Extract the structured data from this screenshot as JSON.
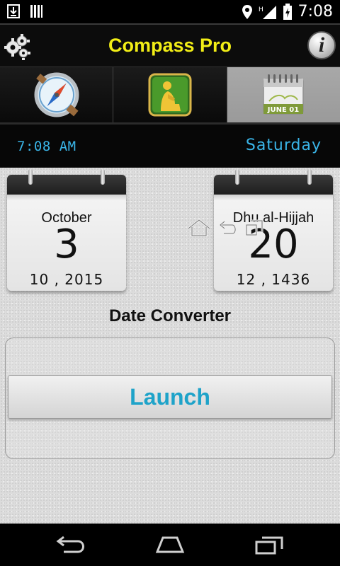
{
  "status_bar": {
    "time": "7:08",
    "icons": [
      "download-icon",
      "sim-bars-icon",
      "location-icon",
      "signal-icon",
      "battery-icon"
    ]
  },
  "header": {
    "title": "Compass Pro",
    "settings_icon": "gear-icon",
    "info_icon": "info-icon",
    "info_glyph": "i"
  },
  "tabs": [
    {
      "name": "compass",
      "icon": "compass-icon",
      "active": false
    },
    {
      "name": "prayer",
      "icon": "prayer-icon",
      "active": false
    },
    {
      "name": "calendar",
      "icon": "calendar-icon",
      "active": true,
      "icon_text": "JUNE 01"
    }
  ],
  "info_strip": {
    "time": "7:08 AM",
    "day": "Saturday"
  },
  "gregorian": {
    "month": "October",
    "day": "3",
    "month_year": "10 , 2015"
  },
  "hijri": {
    "month": "Dhu al-Hijjah",
    "day": "20",
    "month_year": "12 , 1436"
  },
  "converter": {
    "title": "Date Converter",
    "launch_label": "Launch"
  },
  "colors": {
    "title": "#f2ee16",
    "accent": "#3ab5e8",
    "launch_text": "#1ea3c9"
  }
}
